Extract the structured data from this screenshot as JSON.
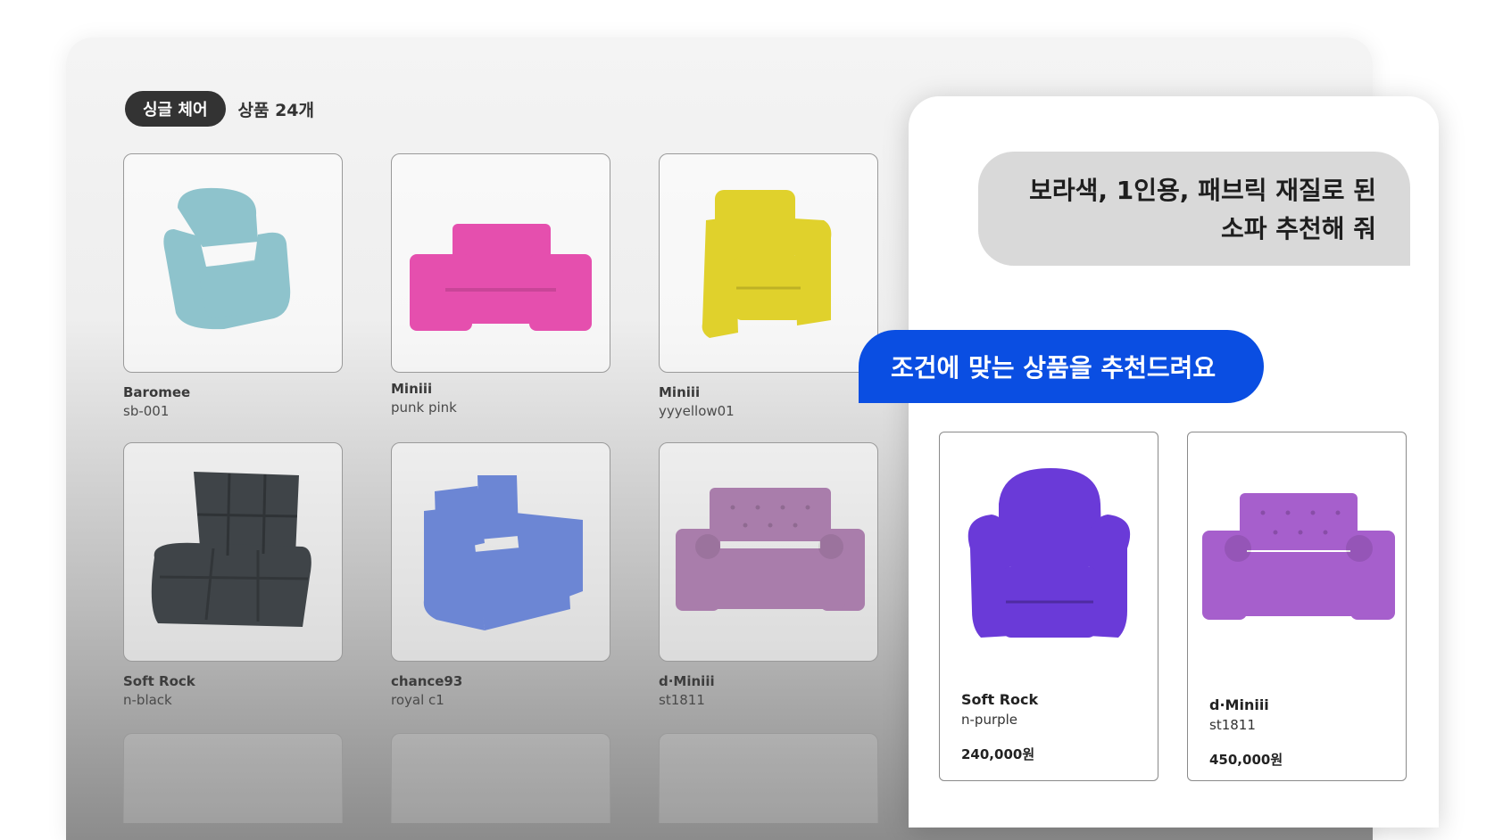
{
  "catalog": {
    "category_chip": "싱글 체어",
    "count_label": "상품 24개",
    "products": [
      {
        "name": "Baromee",
        "code": "sb-001",
        "color": "#8ec3cc",
        "icon": "armchair-recliner-icon"
      },
      {
        "name": "Miniii",
        "code": "punk pink",
        "color": "#e54fae",
        "icon": "loveseat-icon"
      },
      {
        "name": "Miniii",
        "code": "yyyellow01",
        "color": "#e0d12c",
        "icon": "armchair-icon"
      },
      {
        "name": "Soft Rock",
        "code": "n-black",
        "color": "#3f4448",
        "icon": "floor-chair-icon"
      },
      {
        "name": "chance93",
        "code": "royal c1",
        "color": "#6c86d4",
        "icon": "armchair-icon"
      },
      {
        "name": "d·Miniii",
        "code": "st1811",
        "color": "#a97dab",
        "icon": "tufted-loveseat-icon"
      }
    ]
  },
  "chat": {
    "user_message": "보라색, 1인용, 패브릭 재질로 된\n소파 추천해 줘",
    "bot_message": "조건에 맞는 상품을 추천드려요",
    "recommendations": [
      {
        "name": "Soft Rock",
        "code": "n-purple",
        "price": "240,000원",
        "color": "#6a3ad8",
        "icon": "armchair-icon"
      },
      {
        "name": "d·Miniii",
        "code": "st1811",
        "price": "450,000원",
        "color": "#a65fcc",
        "icon": "tufted-loveseat-icon"
      }
    ]
  }
}
